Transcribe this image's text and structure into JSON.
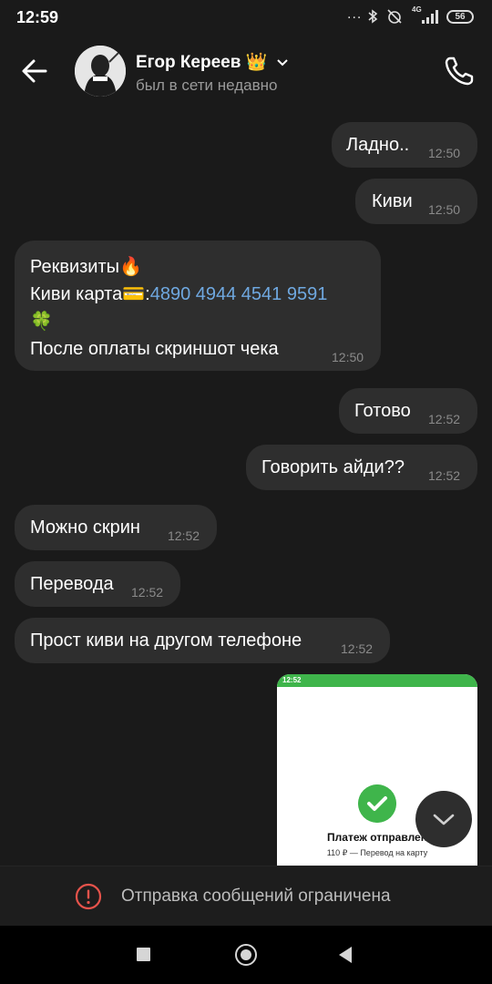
{
  "status_bar": {
    "time": "12:59",
    "dots": "...",
    "battery": "56",
    "network_label": "4G"
  },
  "header": {
    "contact_name": "Егор Кереев",
    "name_badge": "👑",
    "status": "был в сети недавно"
  },
  "messages": [
    {
      "side": "out",
      "text": "Ладно..",
      "time": "12:50"
    },
    {
      "side": "out",
      "text": "Киви",
      "time": "12:50"
    },
    {
      "side": "in",
      "lines": [
        "Реквизиты🔥",
        "Киви карта💳:",
        "🍀",
        "После оплаты скриншот чека"
      ],
      "card_number": "4890 4944 4541 9591",
      "time": "12:50"
    },
    {
      "side": "out",
      "text": "Готово",
      "time": "12:52"
    },
    {
      "side": "out",
      "text": "Говорить айди??",
      "time": "12:52"
    },
    {
      "side": "in",
      "text": "Можно скрин",
      "time": "12:52"
    },
    {
      "side": "in",
      "text": "Перевода",
      "time": "12:52"
    },
    {
      "side": "in",
      "text": "Прост киви на другом телефоне",
      "time": "12:52"
    }
  ],
  "attachment": {
    "status_time": "12:52",
    "title": "Платеж отправлен",
    "subtitle": "110 ₽ — Перевод на карту"
  },
  "restriction": {
    "text": "Отправка сообщений ограничена"
  },
  "colors": {
    "background": "#1a1a1a",
    "bubble": "#2e2e2e",
    "link": "#6fa8e0",
    "time": "#8a8a8a",
    "warning": "#e5534b",
    "qiwi_green": "#3fb54b"
  }
}
